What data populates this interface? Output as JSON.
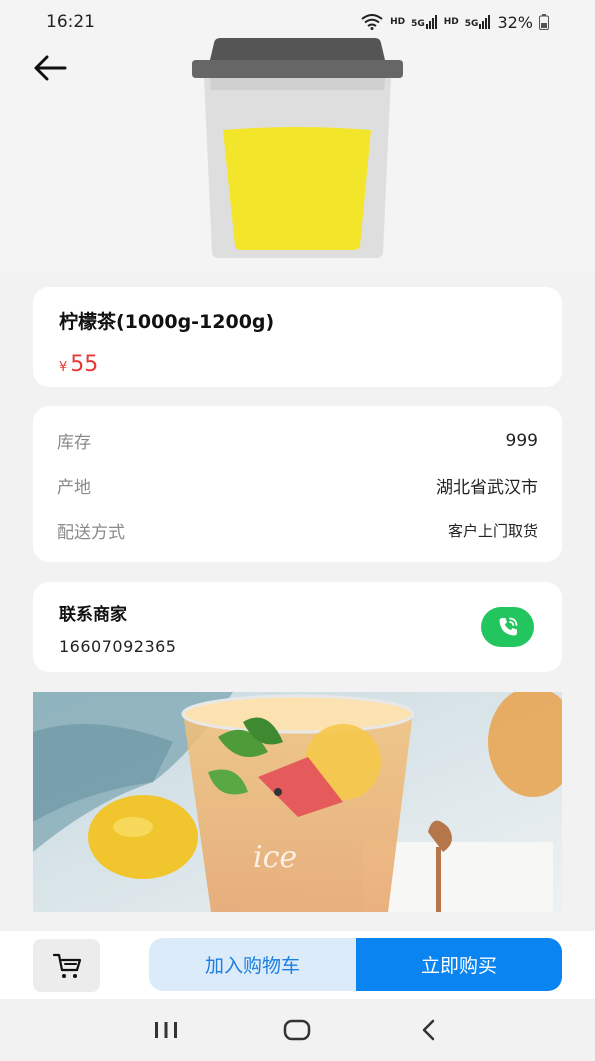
{
  "status_bar": {
    "time": "16:21",
    "battery": "32%",
    "network_labels": [
      "HD",
      "5G",
      "HD",
      "5G"
    ]
  },
  "product": {
    "name": "柠檬茶(1000g-1200g)",
    "currency": "¥",
    "price": "55"
  },
  "info": [
    {
      "label": "库存",
      "value": "999"
    },
    {
      "label": "产地",
      "value": "湖北省武汉市"
    },
    {
      "label": "配送方式",
      "value": "客户上门取货"
    }
  ],
  "contact": {
    "title": "联系商家",
    "phone": "16607092365"
  },
  "actions": {
    "add_to_cart": "加入购物车",
    "buy_now": "立即购买"
  },
  "icons": {
    "back": "back-arrow-icon",
    "call": "phone-icon",
    "cart": "cart-icon",
    "nav": [
      "recent-apps-icon",
      "home-icon",
      "nav-back-icon"
    ]
  },
  "colors": {
    "price": "#e53935",
    "call_button": "#22c55e",
    "buy_button": "#0a84f0",
    "add_button_bg": "#dcebfa",
    "add_button_text": "#1c7fe0"
  }
}
